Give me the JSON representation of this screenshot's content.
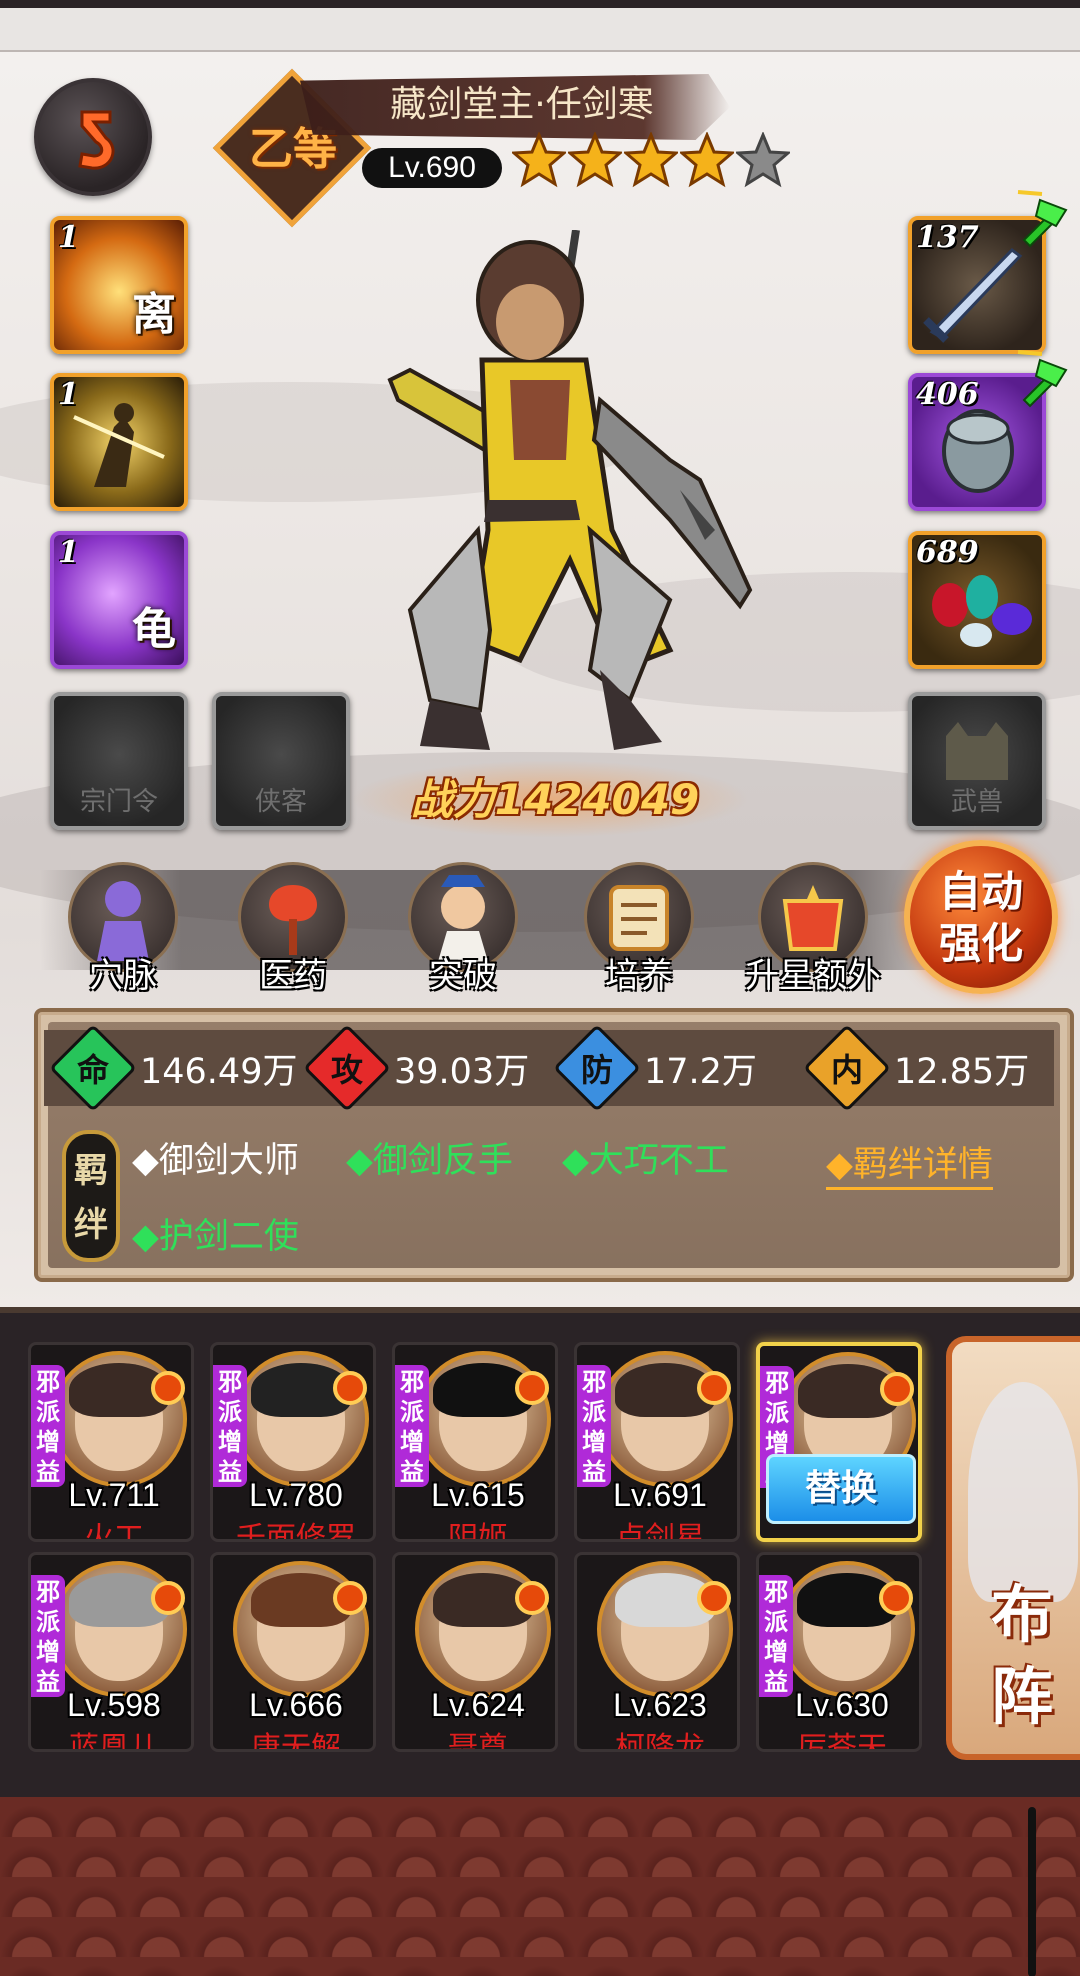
{
  "hero": {
    "grade": "乙等",
    "name": "藏剑堂主·任剑寒",
    "level": "Lv.690",
    "stars_filled": 4,
    "stars_total": 5,
    "power_label": "战力",
    "power_value": "1424049"
  },
  "left_slots": [
    {
      "count": "1",
      "glyph": "离",
      "icon": "flame-fist-skill-icon"
    },
    {
      "count": "1",
      "glyph": "",
      "icon": "sword-warrior-skill-icon"
    },
    {
      "count": "1",
      "glyph": "龟",
      "icon": "purple-tentacle-skill-icon"
    }
  ],
  "right_slots": [
    {
      "count": "137",
      "icon": "sword-equip-icon",
      "upgrade": true
    },
    {
      "count": "406",
      "icon": "bracer-equip-icon",
      "upgrade": true
    },
    {
      "count": "689",
      "icon": "gems-equip-icon",
      "upgrade": false
    }
  ],
  "empty_slots": {
    "sect_token": "宗门令",
    "xiake": "侠客",
    "beast": "武兽"
  },
  "functions": [
    {
      "label": "穴脉",
      "icon": "meridian-icon"
    },
    {
      "label": "医药",
      "icon": "medicine-icon"
    },
    {
      "label": "突破",
      "icon": "breakthrough-icon"
    },
    {
      "label": "培养",
      "icon": "cultivate-icon"
    },
    {
      "label": "升星额外",
      "icon": "star-up-extra-icon"
    }
  ],
  "auto_enhance": "自动强化",
  "stats": [
    {
      "glyph": "命",
      "value": "146.49万",
      "color": "#27c45a"
    },
    {
      "glyph": "攻",
      "value": "39.03万",
      "color": "#e52a2a"
    },
    {
      "glyph": "防",
      "value": "17.2万",
      "color": "#3b8fe0"
    },
    {
      "glyph": "内",
      "value": "12.85万",
      "color": "#e9a229"
    }
  ],
  "bonds": {
    "tag": "羁绊",
    "items": [
      {
        "text": "◆御剑大师",
        "active": false
      },
      {
        "text": "◆御剑反手",
        "active": true
      },
      {
        "text": "◆大巧不工",
        "active": true
      },
      {
        "text": "◆护剑二使",
        "active": true
      }
    ],
    "detail": "◆羁绊详情"
  },
  "roster": [
    {
      "level": "Lv.711",
      "name": "火工",
      "tag": "邪派增益",
      "hair": "#3a2a24"
    },
    {
      "level": "Lv.780",
      "name": "千面修罗",
      "tag": "邪派增益",
      "hair": "#222"
    },
    {
      "level": "Lv.615",
      "name": "阴姬",
      "tag": "邪派增益",
      "hair": "#111"
    },
    {
      "level": "Lv.691",
      "name": "卢剑星",
      "tag": "邪派增益",
      "hair": "#3a2a24"
    },
    {
      "level": "",
      "name": "",
      "tag": "邪派增益",
      "hair": "#3a2a24",
      "selected": true,
      "action": "替换"
    },
    {
      "level": "Lv.598",
      "name": "蓝凰儿",
      "tag": "邪派增益",
      "hair": "#9a9a9a"
    },
    {
      "level": "Lv.666",
      "name": "唐无解",
      "tag": "",
      "hair": "#6a3a22"
    },
    {
      "level": "Lv.624",
      "name": "聂尊",
      "tag": "",
      "hair": "#3a2a24"
    },
    {
      "level": "Lv.623",
      "name": "柯降龙",
      "tag": "",
      "hair": "#d8d8d8"
    },
    {
      "level": "Lv.630",
      "name": "厉苍天",
      "tag": "邪派增益",
      "hair": "#111"
    }
  ],
  "deploy_label": "布阵"
}
